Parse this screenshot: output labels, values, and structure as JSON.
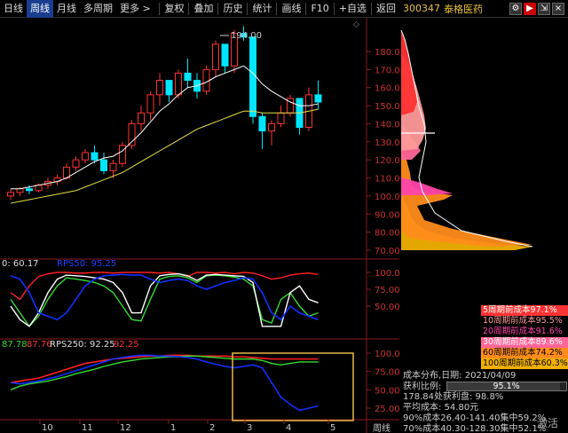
{
  "toolbar": {
    "items": [
      "日线",
      "周线",
      "月线",
      "多周期",
      "更多 >"
    ],
    "active_index": 1,
    "right_items": [
      "复权",
      "叠加",
      "历史",
      "统计",
      "画线",
      "F10",
      "+自选",
      "返回"
    ]
  },
  "header": {
    "code": "300347",
    "name": "泰格医药"
  },
  "price_chart": {
    "y_ticks": [
      "180.0",
      "170.0",
      "160.0",
      "150.0",
      "140.0",
      "130.0",
      "120.0",
      "110.0",
      "100.0",
      "90.00",
      "80.00",
      "70.00"
    ],
    "peak_label": "194.00"
  },
  "indicator1": {
    "label": "0: 60.17",
    "label2": "RPS50: 95.25",
    "y_ticks": [
      "100.0",
      "75.00",
      "50.00"
    ]
  },
  "indicator2": {
    "label_a": "87.78",
    "label_b": "87.76",
    "label_c": "RPS250: 92.25",
    "label_d": "92.25",
    "y_ticks": [
      "100.0",
      "75.00",
      "50.00",
      "25.00"
    ]
  },
  "x_ticks": [
    "10",
    "11",
    "12",
    "1",
    "2",
    "3",
    "4",
    "5"
  ],
  "x_axis_unit": "周线",
  "legend": [
    {
      "label": "5周期前成本97.1%",
      "color": "#ff3333"
    },
    {
      "label": "10周期前成本95.5%",
      "color": "#ff9999"
    },
    {
      "label": "20周期前成本91.6%",
      "color": "#ff44aa"
    },
    {
      "label": "30周期前成本89.6%",
      "color": "#ff6699"
    },
    {
      "label": "60周期前成本74.2%",
      "color": "#ff8c1a"
    },
    {
      "label": "100周期前成本60.3%",
      "color": "#f0b000"
    }
  ],
  "cost_info": {
    "date_line": "成本分布,日期: 2021/04/09",
    "profit_label": "获利比例:",
    "profit_value": "95.1%",
    "profit_fraction": 0.951,
    "line1": "178.84处获利盘: 98.8%",
    "line2": "平均成本: 54.80元",
    "line3": "90%成本26.40-141.40集中59.2%",
    "line4": "70%成本40.30-128.30集中52.1%"
  },
  "watermark": "激活",
  "colors": {
    "up": "#ff3333",
    "down": "#00e5ff",
    "ma1": "#ffffff",
    "ma2": "#e8e04a",
    "rps_red": "#ff2020",
    "rps_blue": "#1030ff",
    "rps_green": "#33dd33",
    "rps_white": "#ffffff",
    "highlight_box": "#e8b84a"
  }
}
